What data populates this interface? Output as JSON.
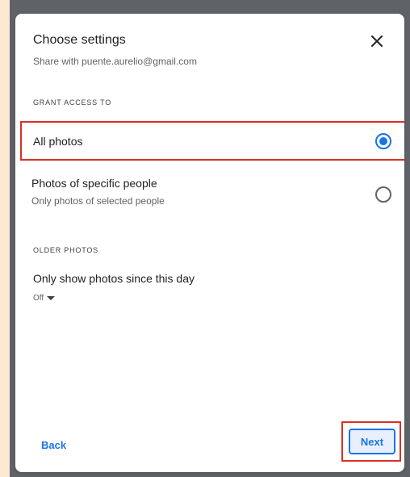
{
  "dialog": {
    "title": "Choose settings",
    "subtitle": "Share with puente.aurelio@gmail.com",
    "close_icon": "close-icon"
  },
  "grant_access": {
    "section_label": "GRANT ACCESS TO",
    "options": [
      {
        "title": "All photos",
        "subtitle": "",
        "selected": true
      },
      {
        "title": "Photos of specific people",
        "subtitle": "Only photos of selected people",
        "selected": false
      }
    ]
  },
  "older_photos": {
    "section_label": "OLDER PHOTOS",
    "title": "Only show photos since this day",
    "dropdown_value": "Off",
    "dropdown_icon": "caret-down-icon"
  },
  "footer": {
    "back_label": "Back",
    "next_label": "Next"
  },
  "colors": {
    "accent": "#1a73e8",
    "highlight": "#d93025",
    "background": "#fbe9d2"
  }
}
